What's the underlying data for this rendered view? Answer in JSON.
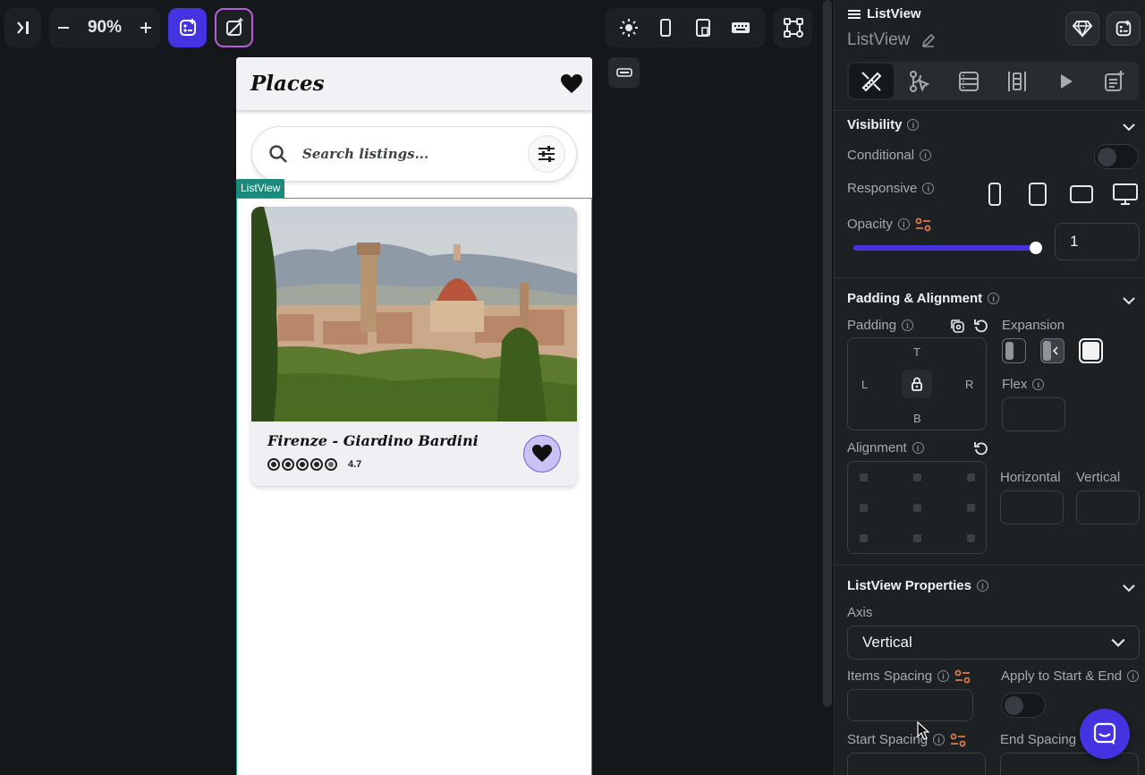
{
  "toolbar": {
    "zoom_value": "90%",
    "icons": [
      "panel-toggle-icon",
      "zoom-out-icon",
      "zoom-in-icon",
      "add-widget-icon",
      "magic-icon",
      "sun-icon",
      "phone-icon",
      "tablet-icon",
      "keyboard-icon",
      "tree-icon"
    ]
  },
  "phone": {
    "title": "Places",
    "search_placeholder": "Search listings...",
    "listview_tag": "ListView",
    "card": {
      "title": "Firenze - Giardino Bardini",
      "rating": "4.7"
    }
  },
  "panel": {
    "widget_type": "ListView",
    "widget_name": "ListView",
    "visibility": {
      "heading": "Visibility",
      "conditional_label": "Conditional",
      "responsive_label": "Responsive",
      "opacity_label": "Opacity",
      "opacity_value": "1",
      "opacity_fraction": 0.98
    },
    "padding_alignment": {
      "heading": "Padding & Alignment",
      "padding_label": "Padding",
      "expansion_label": "Expansion",
      "flex_label": "Flex",
      "top": "T",
      "left": "L",
      "right": "R",
      "bottom": "B",
      "alignment_label": "Alignment",
      "horizontal_label": "Horizontal",
      "vertical_label": "Vertical"
    },
    "listview_properties": {
      "heading": "ListView Properties",
      "axis_label": "Axis",
      "axis_value": "Vertical",
      "items_spacing_label": "Items Spacing",
      "apply_label": "Apply to Start & End",
      "start_spacing_label": "Start Spacing",
      "end_spacing_label": "End Spacing"
    }
  },
  "colors": {
    "accent": "#4433e0",
    "teal": "#1a8a7b",
    "panel_bg": "#1d2124",
    "canvas_bg": "#14181b"
  }
}
